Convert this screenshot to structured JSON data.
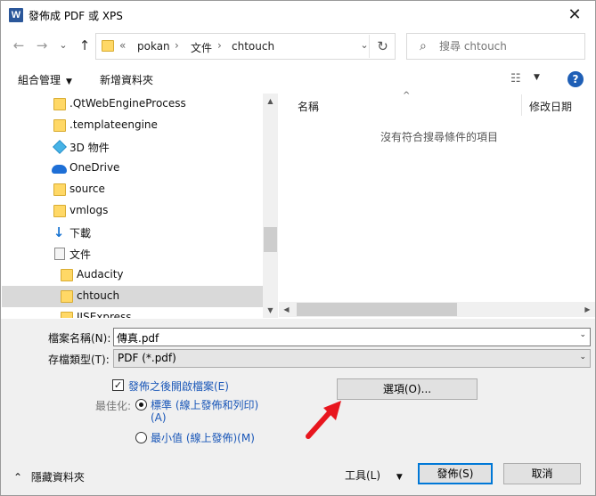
{
  "window": {
    "title": "發佈成 PDF 或 XPS",
    "app_icon_letter": "W",
    "close_symbol": "✕"
  },
  "address_bar": {
    "nav": {
      "back": "←",
      "forward": "→",
      "recent": "⌄",
      "up": "↑"
    },
    "overflow": "«",
    "crumbs": [
      "pokan",
      "文件",
      "chtouch"
    ],
    "separator": "›",
    "dropdown": "⌄",
    "refresh": "↻"
  },
  "search": {
    "icon": "⌕",
    "placeholder": "搜尋 chtouch"
  },
  "toolbar": {
    "organize": "組合管理",
    "organize_caret": "▼",
    "new_folder": "新增資料夾",
    "view_icon": "☷",
    "view_caret": "▼",
    "help": "?"
  },
  "nav_tree": [
    {
      "label": ".QtWebEngineProcess",
      "icon": "folder"
    },
    {
      "label": ".templateengine",
      "icon": "folder"
    },
    {
      "label": "3D 物件",
      "icon": "cube"
    },
    {
      "label": "OneDrive",
      "icon": "cloud"
    },
    {
      "label": "source",
      "icon": "folder"
    },
    {
      "label": "vmlogs",
      "icon": "folder"
    },
    {
      "label": "下載",
      "icon": "download"
    },
    {
      "label": "文件",
      "icon": "document"
    },
    {
      "label": "Audacity",
      "icon": "folder"
    },
    {
      "label": "chtouch",
      "icon": "folder",
      "selected": true
    },
    {
      "label": "IISExpress",
      "icon": "folder"
    }
  ],
  "content": {
    "columns": [
      "名稱",
      "修改日期"
    ],
    "sort_indicator": "^",
    "empty_message": "沒有符合搜尋條件的項目"
  },
  "scroll": {
    "up": "▲",
    "down": "▼",
    "left": "◀",
    "right": "▶"
  },
  "form": {
    "filename_label": "檔案名稱(N):",
    "filename_value": "傳真.pdf",
    "filetype_label": "存檔類型(T):",
    "filetype_value": "PDF (*.pdf)",
    "dropdown_caret": "⌄",
    "open_after_publish": "發佈之後開啟檔案(E)",
    "checkmark": "✓",
    "optimize_label": "最佳化:",
    "opt_standard_line1": "標準 (線上發佈和列印)",
    "opt_standard_line2": "(A)",
    "opt_minimum": "最小值 (線上發佈)(M)",
    "options_button": "選項(O)...",
    "hide_folders": "隱藏資料夾",
    "hide_caret": "⌃",
    "tools_button": "工具(L)",
    "tools_caret": "▼",
    "publish_button": "發佈(S)",
    "cancel_button": "取消"
  },
  "colors": {
    "annotation_arrow": "#e8161e",
    "accent": "#0078d7",
    "link": "#1a57b8"
  }
}
